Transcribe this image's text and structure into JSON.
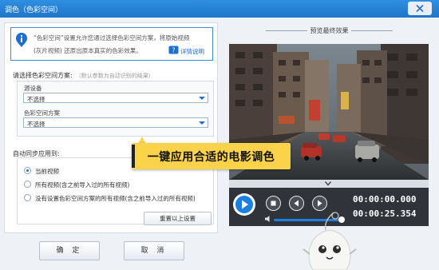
{
  "window": {
    "title": "调色（色彩空间）"
  },
  "info": {
    "line1": "“色彩空间”设置允许您通过选择色彩空间方案，将原始视频",
    "line2": "(灰片视频) 还原出原本真实的色彩效果。",
    "help_link": "详情说明"
  },
  "scheme": {
    "title": "请选择色彩空间方案:",
    "hint": "（默认参数为自动识别的结果）",
    "source_label": "源设备",
    "source_value": "不选择",
    "colorspace_label": "色彩空间方案",
    "colorspace_value": "不选择"
  },
  "sync": {
    "title": "自动同步应用到:",
    "options": [
      {
        "label": "当前视频",
        "selected": true
      },
      {
        "label": "所有视频(含之前导入过的所有视频)",
        "selected": false
      },
      {
        "label": "没有设置色彩空间方案的所有视频(含之前导入过的所有视频)",
        "selected": false
      }
    ],
    "reset_label": "重置以上设置"
  },
  "buttons": {
    "ok": "确 定",
    "cancel": "取 消"
  },
  "preview": {
    "title": "预览最终效果",
    "time_current": "00:00:00.000",
    "time_total": "00:00:25.354",
    "volume": 0.95
  },
  "banner": {
    "text": "一键应用合适的电影调色"
  },
  "colors": {
    "accent": "#1d7fe0",
    "title_bar": "#2783d6",
    "banner": "#fbd34a"
  },
  "icons": [
    "info-icon",
    "help-icon",
    "close-icon",
    "dropdown-arrow-icon",
    "play-icon",
    "stop-icon",
    "prev-icon",
    "next-icon",
    "volume-icon",
    "chevron-down-icon"
  ]
}
